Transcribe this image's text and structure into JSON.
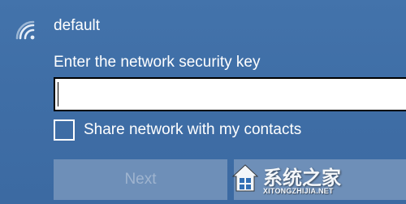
{
  "network": {
    "name": "default",
    "icon": "wifi-icon"
  },
  "security_key": {
    "label": "Enter the network security key",
    "value": "",
    "placeholder": ""
  },
  "share": {
    "label": "Share network with my contacts",
    "checked": false
  },
  "buttons": {
    "next_label": "Next",
    "next_enabled": false,
    "cancel_label": ""
  },
  "watermark": {
    "brand": "系统之家",
    "domain": "XITONGZHIJIA.NET"
  },
  "colors": {
    "panel_background": "#3f6ea6",
    "input_background": "#ffffff",
    "input_border": "#000000",
    "button_background": "#6e8fb8",
    "disabled_text": "#9fb4cf"
  }
}
